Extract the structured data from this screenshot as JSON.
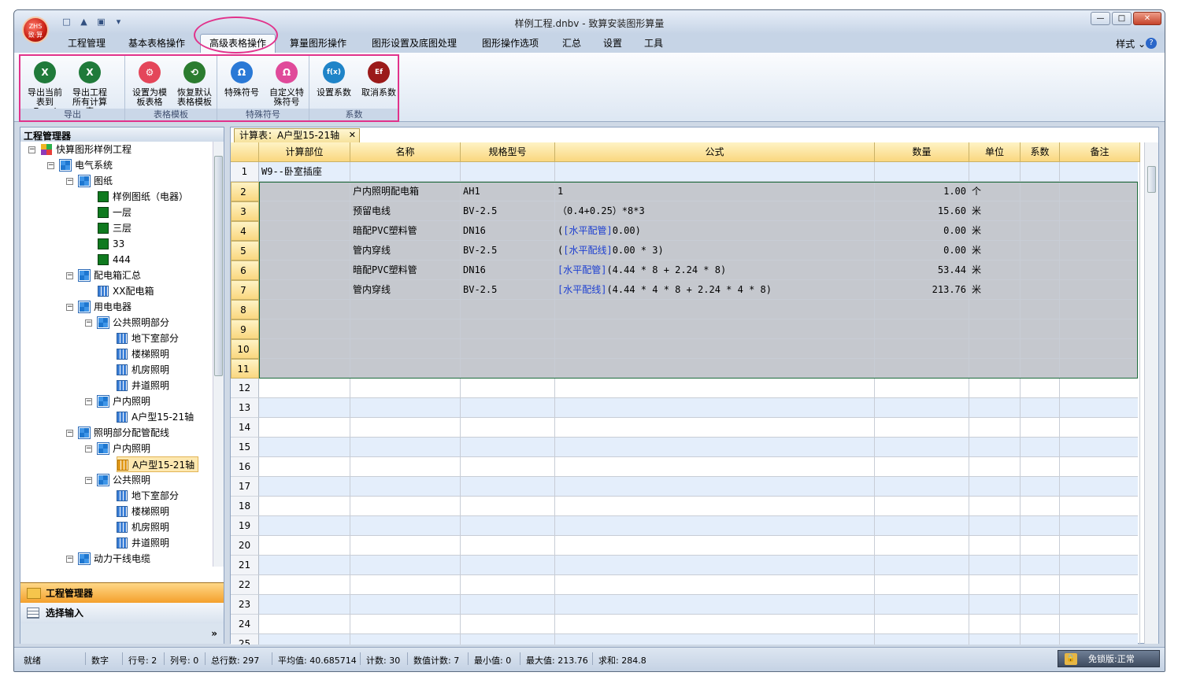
{
  "window": {
    "title": "样例工程.dnbv - 致算安装图形算量",
    "logo": "ZHS\n致·算"
  },
  "tabs": [
    "工程管理",
    "基本表格操作",
    "高级表格操作",
    "算量图形操作",
    "图形设置及底图处理",
    "图形操作选项",
    "汇总",
    "设置",
    "工具"
  ],
  "style_menu": "样式",
  "ribbon": {
    "groups": [
      {
        "label": "导出",
        "buttons": [
          {
            "label": "导出当前表到 Excel",
            "icon": "excel-icon"
          },
          {
            "label": "导出工程所有计算表",
            "icon": "excel-icon"
          }
        ]
      },
      {
        "label": "表格模板",
        "buttons": [
          {
            "label": "设置为模板表格",
            "icon": "template-icon"
          },
          {
            "label": "恢复默认表格模板",
            "icon": "restore-icon"
          }
        ]
      },
      {
        "label": "特殊符号",
        "buttons": [
          {
            "label": "特殊符号",
            "icon": "omega-icon"
          },
          {
            "label": "自定义特殊符号",
            "icon": "custom-symbol-icon"
          }
        ]
      },
      {
        "label": "系数",
        "buttons": [
          {
            "label": "设置系数",
            "icon": "fx-icon"
          },
          {
            "label": "取消系数",
            "icon": "efx-icon"
          }
        ]
      }
    ]
  },
  "tree": {
    "title": "工程管理器",
    "nodes": [
      {
        "label": "快算图形样例工程",
        "level": 0,
        "icon": "multi",
        "toggle": "-"
      },
      {
        "label": "电气系统",
        "level": 1,
        "icon": "win",
        "toggle": "-"
      },
      {
        "label": "图纸",
        "level": 2,
        "icon": "win",
        "toggle": "-"
      },
      {
        "label": "样例图纸（电器）",
        "level": 3,
        "icon": "green"
      },
      {
        "label": "一层",
        "level": 3,
        "icon": "green"
      },
      {
        "label": "三层",
        "level": 3,
        "icon": "green"
      },
      {
        "label": "33",
        "level": 3,
        "icon": "green"
      },
      {
        "label": "444",
        "level": 3,
        "icon": "green"
      },
      {
        "label": "配电箱汇总",
        "level": 2,
        "icon": "win",
        "toggle": "-"
      },
      {
        "label": "XX配电箱",
        "level": 3,
        "icon": "grid"
      },
      {
        "label": "用电电器",
        "level": 2,
        "icon": "win",
        "toggle": "-"
      },
      {
        "label": "公共照明部分",
        "level": 3,
        "icon": "win",
        "toggle": "-"
      },
      {
        "label": "地下室部分",
        "level": 4,
        "icon": "grid"
      },
      {
        "label": "楼梯照明",
        "level": 4,
        "icon": "grid"
      },
      {
        "label": "机房照明",
        "level": 4,
        "icon": "grid"
      },
      {
        "label": "井道照明",
        "level": 4,
        "icon": "grid"
      },
      {
        "label": "户内照明",
        "level": 3,
        "icon": "win",
        "toggle": "-"
      },
      {
        "label": "A户型15-21轴",
        "level": 4,
        "icon": "grid"
      },
      {
        "label": "照明部分配管配线",
        "level": 2,
        "icon": "win",
        "toggle": "-"
      },
      {
        "label": "户内照明",
        "level": 3,
        "icon": "win",
        "toggle": "-"
      },
      {
        "label": "A户型15-21轴",
        "level": 4,
        "icon": "grid2",
        "selected": true
      },
      {
        "label": "公共照明",
        "level": 3,
        "icon": "win",
        "toggle": "-"
      },
      {
        "label": "地下室部分",
        "level": 4,
        "icon": "grid"
      },
      {
        "label": "楼梯照明",
        "level": 4,
        "icon": "grid"
      },
      {
        "label": "机房照明",
        "level": 4,
        "icon": "grid"
      },
      {
        "label": "井道照明",
        "level": 4,
        "icon": "grid"
      },
      {
        "label": "动力干线电缆",
        "level": 2,
        "icon": "win",
        "toggle": "-"
      }
    ]
  },
  "nav": {
    "manager": "工程管理器",
    "select": "选择输入",
    "more": "»"
  },
  "doc_tab": "计算表：A户型15-21轴",
  "columns": [
    "计算部位",
    "名称",
    "规格型号",
    "公式",
    "数量",
    "单位",
    "系数",
    "备注"
  ],
  "rows": [
    {
      "n": "1",
      "cells": [
        "W9--卧室插座",
        "",
        "",
        "",
        "",
        "",
        "",
        ""
      ]
    },
    {
      "n": "2",
      "cells": [
        "",
        "户内照明配电箱",
        "AH1",
        "1",
        "1.00",
        "个",
        "",
        ""
      ]
    },
    {
      "n": "3",
      "cells": [
        "",
        "预留电线",
        "BV-2.5",
        "（0.4+0.25）*8*3",
        "15.60",
        "米",
        "",
        ""
      ]
    },
    {
      "n": "4",
      "cells": [
        "",
        "暗配PVC塑料管",
        "DN16",
        "([水平配管]0.00)",
        "0.00",
        "米",
        "",
        ""
      ]
    },
    {
      "n": "5",
      "cells": [
        "",
        "管内穿线",
        "BV-2.5",
        "([水平配线]0.00 * 3)",
        "0.00",
        "米",
        "",
        ""
      ]
    },
    {
      "n": "6",
      "cells": [
        "",
        "暗配PVC塑料管",
        "DN16",
        "[水平配管](4.44 * 8 + 2.24 * 8)",
        "53.44",
        "米",
        "",
        ""
      ]
    },
    {
      "n": "7",
      "cells": [
        "",
        "管内穿线",
        "BV-2.5",
        "[水平配线](4.44 * 4 * 8 + 2.24 * 4 * 8)",
        "213.76",
        "米",
        "",
        ""
      ]
    },
    {
      "n": "8",
      "cells": [
        "",
        "",
        "",
        "",
        "",
        "",
        "",
        ""
      ]
    },
    {
      "n": "9",
      "cells": [
        "",
        "",
        "",
        "",
        "",
        "",
        "",
        ""
      ]
    },
    {
      "n": "10",
      "cells": [
        "",
        "",
        "",
        "",
        "",
        "",
        "",
        ""
      ]
    },
    {
      "n": "11",
      "cells": [
        "",
        "",
        "",
        "",
        "",
        "",
        "",
        ""
      ]
    },
    {
      "n": "12",
      "cells": [
        "",
        "",
        "",
        "",
        "",
        "",
        "",
        ""
      ]
    },
    {
      "n": "13",
      "cells": [
        "",
        "",
        "",
        "",
        "",
        "",
        "",
        ""
      ]
    },
    {
      "n": "14",
      "cells": [
        "",
        "",
        "",
        "",
        "",
        "",
        "",
        ""
      ]
    },
    {
      "n": "15",
      "cells": [
        "",
        "",
        "",
        "",
        "",
        "",
        "",
        ""
      ]
    },
    {
      "n": "16",
      "cells": [
        "",
        "",
        "",
        "",
        "",
        "",
        "",
        ""
      ]
    },
    {
      "n": "17",
      "cells": [
        "",
        "",
        "",
        "",
        "",
        "",
        "",
        ""
      ]
    },
    {
      "n": "18",
      "cells": [
        "",
        "",
        "",
        "",
        "",
        "",
        "",
        ""
      ]
    },
    {
      "n": "19",
      "cells": [
        "",
        "",
        "",
        "",
        "",
        "",
        "",
        ""
      ]
    },
    {
      "n": "20",
      "cells": [
        "",
        "",
        "",
        "",
        "",
        "",
        "",
        ""
      ]
    },
    {
      "n": "21",
      "cells": [
        "",
        "",
        "",
        "",
        "",
        "",
        "",
        ""
      ]
    },
    {
      "n": "22",
      "cells": [
        "",
        "",
        "",
        "",
        "",
        "",
        "",
        ""
      ]
    },
    {
      "n": "23",
      "cells": [
        "",
        "",
        "",
        "",
        "",
        "",
        "",
        ""
      ]
    },
    {
      "n": "24",
      "cells": [
        "",
        "",
        "",
        "",
        "",
        "",
        "",
        ""
      ]
    },
    {
      "n": "25",
      "cells": [
        "",
        "",
        "",
        "",
        "",
        "",
        "",
        ""
      ]
    }
  ],
  "status": [
    "就绪",
    "数字",
    "行号: 2",
    "列号: 0",
    "总行数: 297",
    "平均值: 40.685714",
    "计数: 30",
    "数值计数: 7",
    "最小值: 0",
    "最大值: 213.76",
    "求和: 284.8"
  ],
  "license": "免锁版:正常",
  "colors": {
    "accent": "#e1328b",
    "selection": "#c5c8ce",
    "header": "#fad77f",
    "formula_ref": "#1d3fd0"
  }
}
